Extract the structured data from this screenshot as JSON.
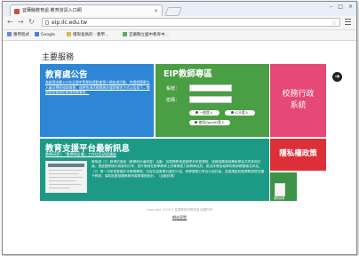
{
  "browser": {
    "tab_title": "宜蘭縣教育處-教育資訊入口網",
    "tab_close": "×",
    "address": "eip.ilc.edu.tw",
    "window_controls": [
      "–",
      "□",
      "×"
    ],
    "bookmarks": [
      "應用程式",
      "Google",
      "僅限會員的 - 教學...",
      "宜蘭縣立國中教育中..."
    ]
  },
  "page": {
    "section_title": "主要服務",
    "announcement": {
      "title": "教育處公告",
      "news": "為辦理本縣103年全國中等學校運動會第十期各項活動，特請相關單位人員及學校協助辦理，茲將各項活動實施計畫與報名方式公告如下，敬請各校依規定辦理相關事宜。"
    },
    "eip": {
      "title": "EIP教師專區",
      "account_label": "帳號：",
      "password_label": "密碼：",
      "btn_login": "一般登入",
      "btn_ic": "IC卡登入",
      "btn_openid": "使用OpenID登入"
    },
    "admin_tile": {
      "line1": "校務行政",
      "line2": "系統"
    },
    "platform": {
      "title": "教育支援平台最新訊息",
      "subtitle": "教師研習 | 「數學與計畫」工作坊及研習講座",
      "body": "教育處（1）數學的奧秘（數學與計畫研習）活動：宜蘭縣教育處辦理本研習課程，邀請相關領域專家學者共同參與討論，透過實際操作與案例分享，提升教師在數學教學上的專業能力與教學品質，歡迎本縣各級學校教師踴躍報名參加。（2）第一次研習會議於本學期舉辦，內容包括數學計畫的介紹、教學實務分享及分組討論，並邀請各校推薦教師擔任種子教師，協助推廣相關教學資源與課程設計。（活動詳情）"
    },
    "privacy_tile": "隱私權政策",
    "small_tile_label": "服務說明",
    "footer": "Copyright ©2013 宜蘭縣政府教育處 版權所有",
    "footer_link": "網站導覽"
  }
}
